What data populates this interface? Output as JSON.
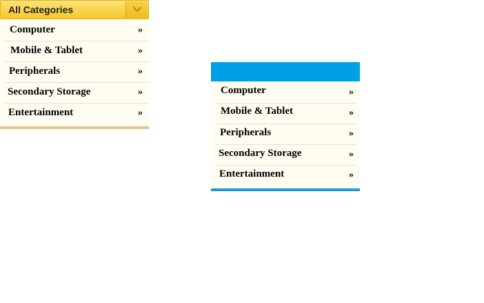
{
  "menu_yellow": {
    "title": "All Categories",
    "toggle_icon": "chevron-down-icon",
    "accent": "#f5c928",
    "items": [
      {
        "label": "Computer",
        "arrow": "»"
      },
      {
        "label": "Mobile & Tablet",
        "arrow": "»"
      },
      {
        "label": "Peripherals",
        "arrow": "»"
      },
      {
        "label": "Secondary Storage",
        "arrow": "»"
      },
      {
        "label": "Entertainment",
        "arrow": "»"
      }
    ]
  },
  "menu_blue": {
    "accent": "#00a0e6",
    "items": [
      {
        "label": "Computer",
        "arrow": "»"
      },
      {
        "label": "Mobile & Tablet",
        "arrow": "»"
      },
      {
        "label": "Peripherals",
        "arrow": "»"
      },
      {
        "label": "Secondary Storage",
        "arrow": "»"
      },
      {
        "label": "Entertainment",
        "arrow": "»"
      }
    ]
  }
}
